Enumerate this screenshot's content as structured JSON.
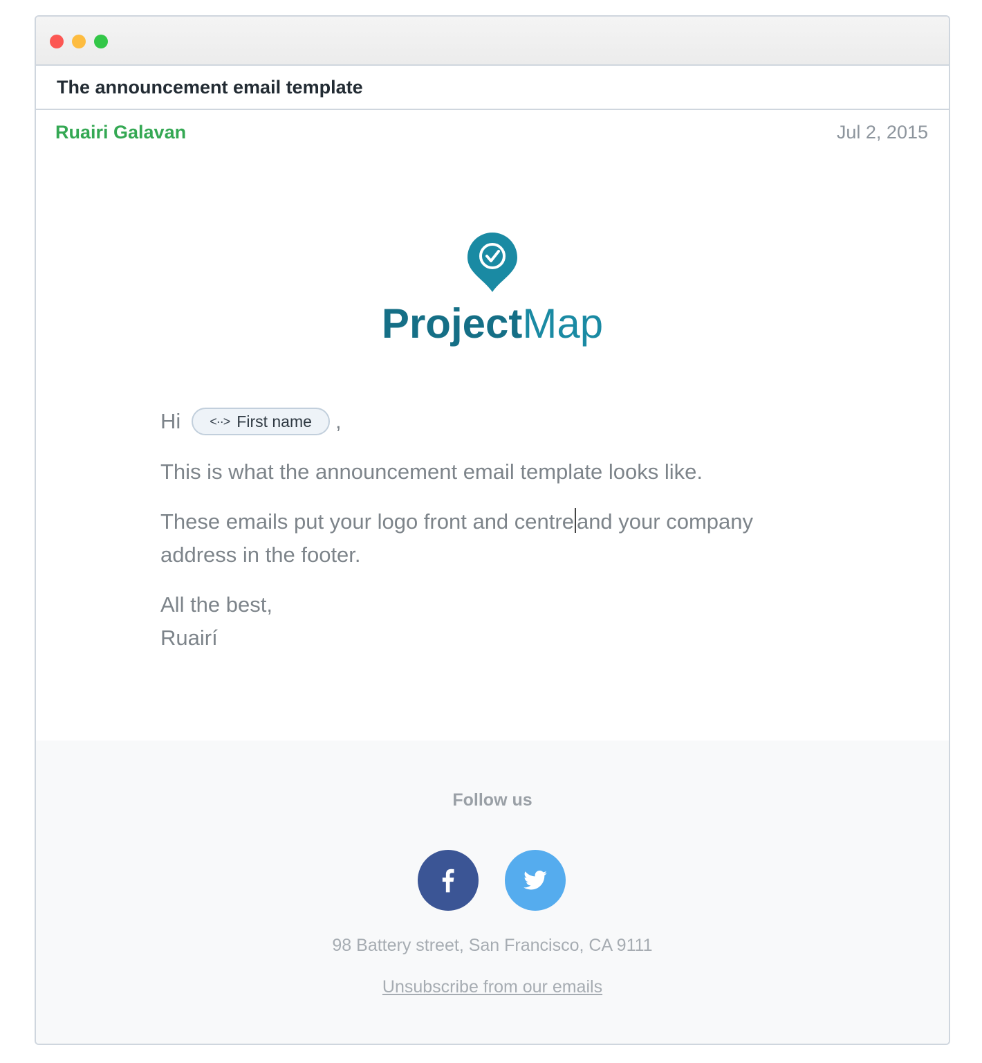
{
  "window": {
    "subject": "The announcement email template"
  },
  "email": {
    "sender": "Ruairi Galavan",
    "date": "Jul 2, 2015",
    "logo_text_bold": "Project",
    "logo_text_light": "Map",
    "greeting": "Hi",
    "merge_tag": "First name",
    "merge_tag_icon": "<··>",
    "greeting_suffix": ",",
    "paragraph_1": "This is what the announcement email template looks like.",
    "paragraph_2_before_cursor": "These emails put your logo front and centre",
    "paragraph_2_after_cursor": "and your company address in the footer.",
    "signoff": "All the best,",
    "signature": "Ruairí"
  },
  "footer": {
    "follow_label": "Follow us",
    "social": [
      {
        "name": "facebook-icon",
        "color": "#3b5595"
      },
      {
        "name": "twitter-icon",
        "color": "#55acee"
      }
    ],
    "address": "98 Battery street, San Francisco, CA 9111",
    "unsubscribe_label": "Unsubscribe from our emails"
  },
  "colors": {
    "sender": "#34a853",
    "logo_teal": "#1a8aa3",
    "logo_dark": "#156f86"
  }
}
